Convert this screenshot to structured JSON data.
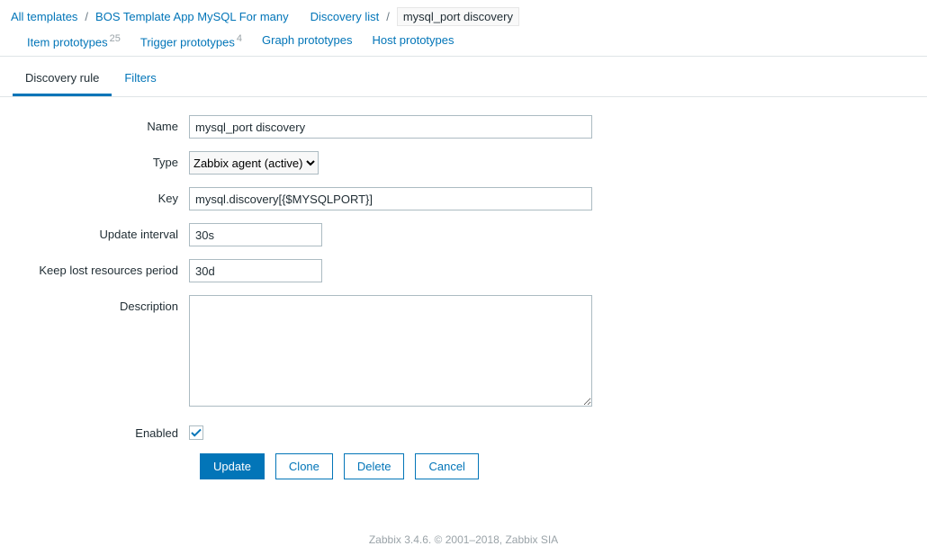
{
  "breadcrumbs": {
    "all_templates": "All templates",
    "template_app": "BOS Template App MySQL For many",
    "discovery_list": "Discovery list",
    "current": "mysql_port discovery"
  },
  "nav_links": {
    "item_prototypes": {
      "label": "Item prototypes",
      "count": "25"
    },
    "trigger_prototypes": {
      "label": "Trigger prototypes",
      "count": "4"
    },
    "graph_prototypes": {
      "label": "Graph prototypes"
    },
    "host_prototypes": {
      "label": "Host prototypes"
    }
  },
  "tabs": {
    "discovery_rule": "Discovery rule",
    "filters": "Filters"
  },
  "form": {
    "labels": {
      "name": "Name",
      "type": "Type",
      "key": "Key",
      "update_interval": "Update interval",
      "keep_lost": "Keep lost resources period",
      "description": "Description",
      "enabled": "Enabled"
    },
    "values": {
      "name": "mysql_port discovery",
      "type_selected": "Zabbix agent (active)",
      "key": "mysql.discovery[{$MYSQLPORT}]",
      "update_interval": "30s",
      "keep_lost": "30d",
      "description": "",
      "enabled": true
    }
  },
  "buttons": {
    "update": "Update",
    "clone": "Clone",
    "delete": "Delete",
    "cancel": "Cancel"
  },
  "footer": "Zabbix 3.4.6. © 2001–2018, Zabbix SIA"
}
